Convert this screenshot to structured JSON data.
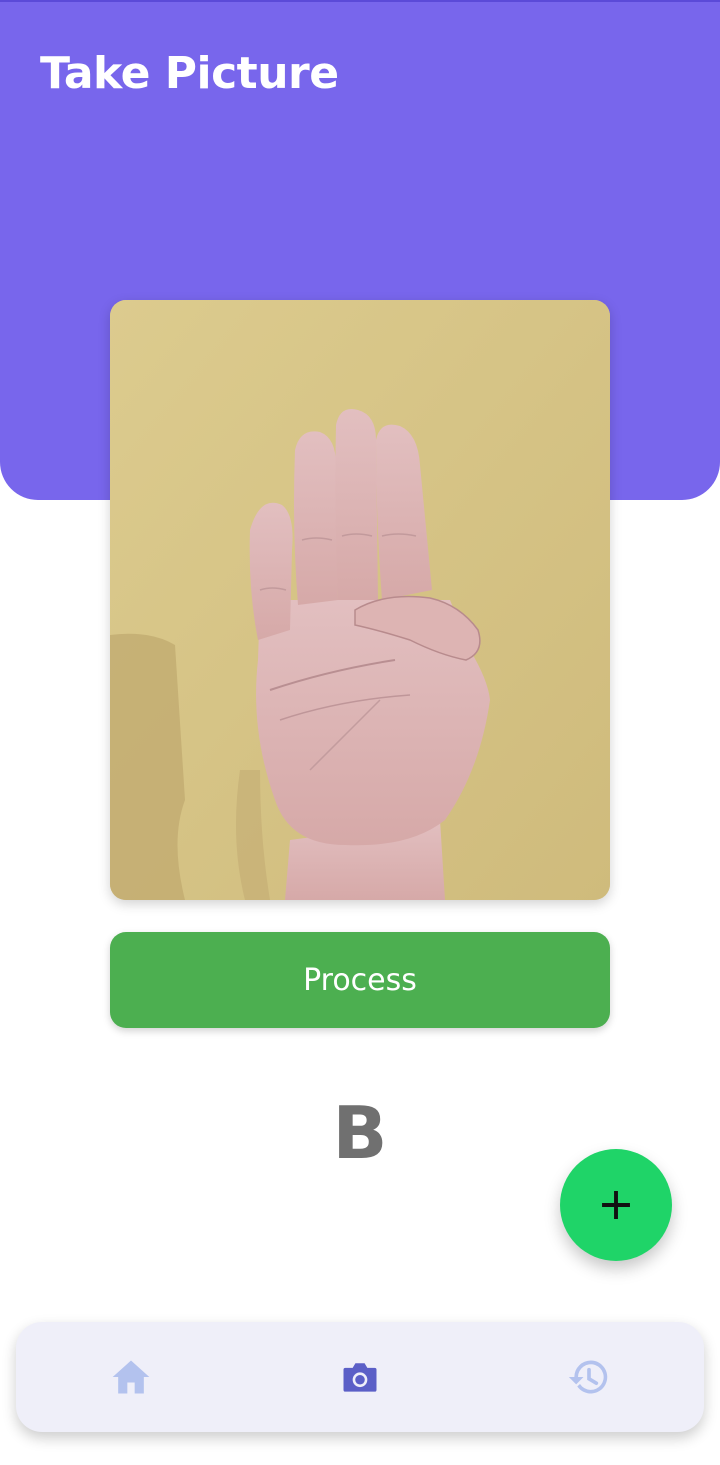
{
  "header": {
    "title": "Take Picture"
  },
  "photo": {
    "subject": "hand-sign-photo"
  },
  "actions": {
    "process_label": "Process"
  },
  "result": {
    "letter": "B"
  },
  "fab": {
    "icon": "plus-icon"
  },
  "bottom_nav": {
    "items": [
      {
        "icon": "home-icon",
        "active": false
      },
      {
        "icon": "camera-icon",
        "active": true
      },
      {
        "icon": "history-icon",
        "active": false
      }
    ]
  },
  "colors": {
    "header_bg": "#7866ec",
    "process_bg": "#4caf50",
    "fab_bg": "#1fd468",
    "nav_bg": "#efeff9",
    "nav_active": "#5b5fc7",
    "nav_inactive": "#b3c2ee"
  }
}
